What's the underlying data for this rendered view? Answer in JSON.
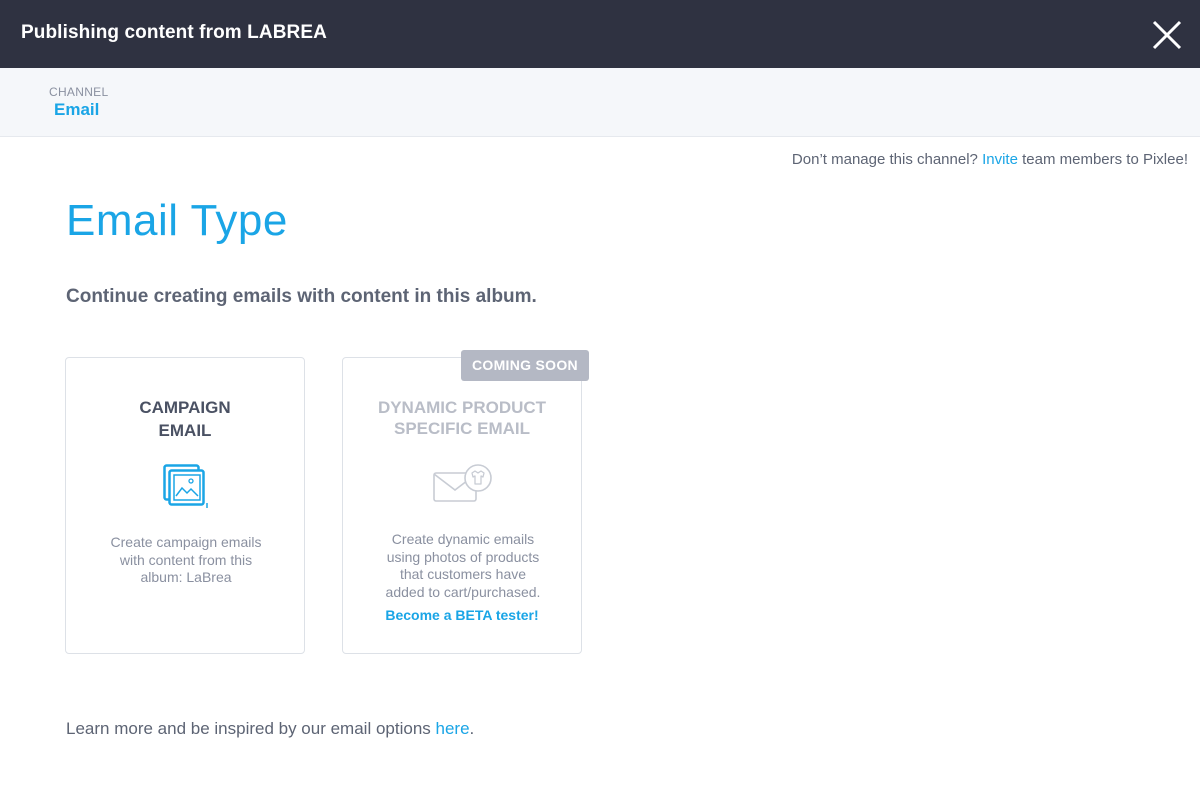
{
  "header": {
    "title": "Publishing content from LABREA"
  },
  "channel": {
    "label": "CHANNEL",
    "value": "Email"
  },
  "invite": {
    "prefix": "Don’t manage this channel?",
    "link": "Invite",
    "suffix": "team members to Pixlee!"
  },
  "page": {
    "heading": "Email Type",
    "subheading": "Continue creating emails with content in this album."
  },
  "cards": [
    {
      "title_line1": "CAMPAIGN",
      "title_line2": "EMAIL",
      "icon": "photo-album-icon",
      "desc_lines": [
        "Create campaign emails",
        "with content from this",
        "album: LaBrea"
      ]
    },
    {
      "title_line1": "DYNAMIC PRODUCT",
      "title_line2": "SPECIFIC EMAIL",
      "icon": "product-email-icon",
      "badge": "COMING SOON",
      "desc_lines": [
        "Create dynamic emails",
        "using photos of products",
        "that customers have",
        "added to cart/purchased."
      ],
      "cta": "Become a BETA tester!"
    }
  ],
  "learn_more": {
    "text": "Learn more and be inspired by our email options",
    "link": "here",
    "end": "."
  },
  "colors": {
    "header_bg": "#2f3241",
    "accent": "#1aa5e6",
    "badge_bg": "#b4b8c4"
  }
}
